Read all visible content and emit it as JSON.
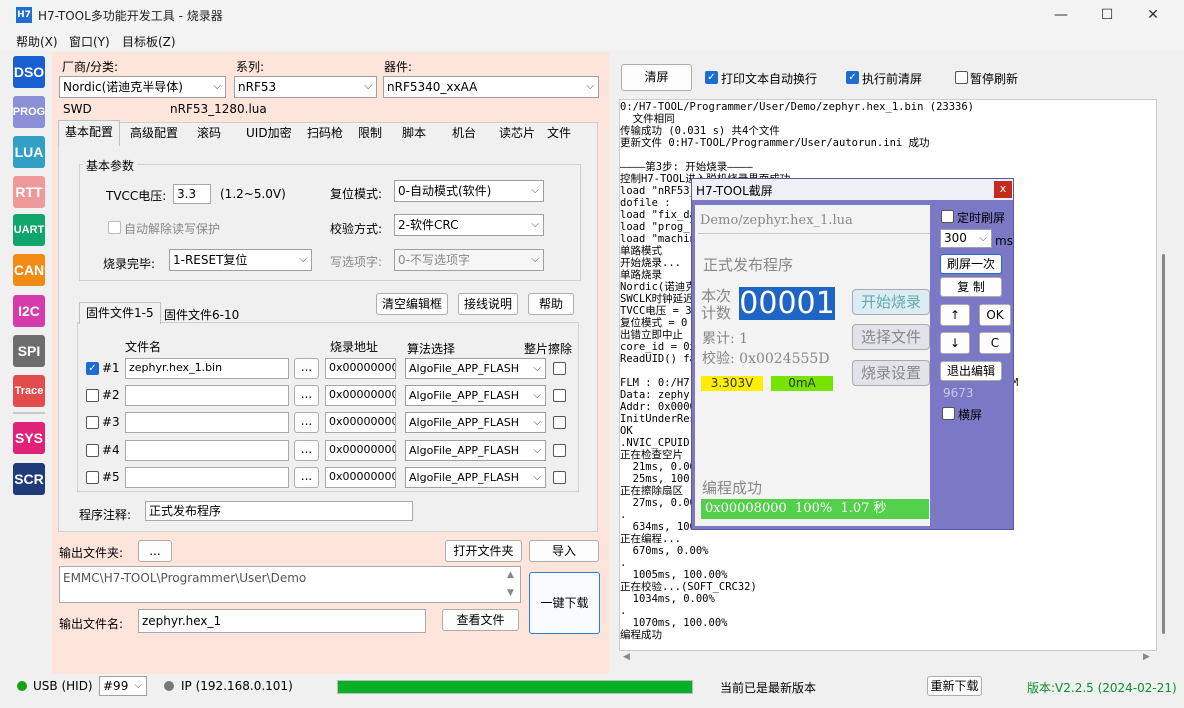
{
  "window": {
    "title": "H7-TOOL多功能开发工具 - 烧录器",
    "app_icon": "H7"
  },
  "menu": [
    "帮助(X)",
    "窗口(Y)",
    "目标板(Z)"
  ],
  "sidebar": [
    {
      "label": "DSO",
      "color": "#1a5fcf"
    },
    {
      "label": "PROG",
      "color": "#8a8fd6"
    },
    {
      "label": "LUA",
      "color": "#32a0c4"
    },
    {
      "label": "RTT",
      "color": "#ef9a9a"
    },
    {
      "label": "UART",
      "color": "#10a56a"
    },
    {
      "label": "CAN",
      "color": "#f28b16"
    },
    {
      "label": "I2C",
      "color": "#d63bab"
    },
    {
      "label": "SPI",
      "color": "#6d6d6d"
    },
    {
      "label": "Trace",
      "color": "#e24c4c"
    },
    {
      "label": "SYS",
      "color": "#e02279"
    },
    {
      "label": "SCR",
      "color": "#1f3b7a"
    }
  ],
  "selectors": {
    "vendor_label": "厂商/分类:",
    "vendor": "Nordic(诺迪克半导体)",
    "series_label": "系列:",
    "series": "nRF53",
    "device_label": "器件:",
    "device": "nRF5340_xxAA",
    "interface": "SWD",
    "lua_file": "nRF53_1280.lua"
  },
  "tabs": [
    "基本配置",
    "高级配置",
    "滚码",
    "UID加密",
    "扫码枪",
    "限制",
    "脚本",
    "机台",
    "读芯片",
    "文件"
  ],
  "basic": {
    "group_title": "基本参数",
    "tvcc_label": "TVCC电压:",
    "tvcc_value": "3.3",
    "tvcc_range": "(1.2~5.0V)",
    "reset_label": "复位模式:",
    "reset_value": "0-自动模式(软件)",
    "auto_unlock_label": "自动解除读写保护",
    "verify_label": "校验方式:",
    "verify_value": "2-软件CRC",
    "finish_label": "烧录完毕:",
    "finish_value": "1-RESET复位",
    "write_opt_label": "写选项字:",
    "write_opt_value": "0-不写选项字"
  },
  "firmware": {
    "tabs": [
      "固件文件1-5",
      "固件文件6-10"
    ],
    "clear_btn": "清空编辑框",
    "wiring_btn": "接线说明",
    "help_btn": "帮助",
    "col_file": "文件名",
    "col_addr": "烧录地址",
    "col_algo": "算法选择",
    "col_erase": "整片擦除",
    "browse": "...",
    "rows": [
      {
        "id": "#1",
        "checked": true,
        "file": "zephyr.hex_1.bin",
        "addr": "0x00000000",
        "algo": "AlgoFile_APP_FLASH"
      },
      {
        "id": "#2",
        "checked": false,
        "file": "",
        "addr": "0x00000000",
        "algo": "AlgoFile_APP_FLASH"
      },
      {
        "id": "#3",
        "checked": false,
        "file": "",
        "addr": "0x00000000",
        "algo": "AlgoFile_APP_FLASH"
      },
      {
        "id": "#4",
        "checked": false,
        "file": "",
        "addr": "0x00000000",
        "algo": "AlgoFile_APP_FLASH"
      },
      {
        "id": "#5",
        "checked": false,
        "file": "",
        "addr": "0x00000000",
        "algo": "AlgoFile_APP_FLASH"
      }
    ],
    "note_label": "程序注释:",
    "note_value": "正式发布程序"
  },
  "output": {
    "folder_label": "输出文件夹:",
    "folder_btn": "...",
    "open_folder_btn": "打开文件夹",
    "import_btn": "导入",
    "path": "EMMC\\H7-TOOL\\Programmer\\User\\Demo",
    "one_click_btn": "一键下载",
    "name_label": "输出文件名:",
    "name_value": "zephyr.hex_1",
    "view_btn": "查看文件"
  },
  "log_toolbar": {
    "clear_btn": "清屏",
    "wrap_label": "打印文本自动换行",
    "clear_before_label": "执行前清屏",
    "pause_label": "暂停刷新"
  },
  "log_lines": [
    "0:/H7-TOOL/Programmer/User/Demo/zephyr.hex_1.bin (23336)",
    "  文件相同",
    "传输成功 (0.031 s) 共4个文件",
    "更新文件 0:H7-TOOL/Programmer/User/autorun.ini 成功",
    "",
    "————第3步: 开始烧录————",
    "控制H7-TOOL进入脱机烧录界面成功",
    "load \"nRF53_",
    "dofile :",
    "load \"fix_da",
    "load \"prog_l",
    "load \"machin",
    "单路模式",
    "开始烧录...",
    "单路烧录",
    "Nordic(诺迪克",
    "SWCLK时钟延迟",
    "TVCC电压 = 3",
    "复位模式 = 0",
    "出错立即中止",
    "core_id = 0x",
    "ReadUID() fa",
    "",
    "FLM : 0:/H7-                                                FLM",
    "Data: zephyr",
    "Addr: 0x0000",
    "InitUnderRes",
    "OK",
    ".NVIC_CPUID",
    "正在检查空片",
    "  21ms, 0.00",
    "  25ms, 100.",
    "正在擦除扇区",
    "  27ms, 0.00",
    ".",
    "  634ms, 100",
    "正在编程...",
    "  670ms, 0.00%",
    ".",
    "  1005ms, 100.00%",
    "正在校验...(SOFT_CRC32)",
    "  1034ms, 0.00%",
    ".",
    "  1070ms, 100.00%",
    "编程成功"
  ],
  "dialog": {
    "title": "H7-TOOL截屏",
    "close": "x",
    "file": "Demo/zephyr.hex_1.lua",
    "program": "正式发布程序",
    "count_label1": "本次",
    "count_label2": "计数",
    "count": "00001",
    "start_btn": "开始烧录",
    "total_label": "累计: 1",
    "select_btn": "选择文件",
    "checksum_label": "校验: 0x0024555D",
    "voltage": "3.303V",
    "current": "0mA",
    "settings_btn": "烧录设置",
    "status": "编程成功",
    "result": "0x00008000  100%  1.07 秒",
    "timer_label": "定时刷屏",
    "interval": "300",
    "ms": "ms",
    "refresh_btn": "刷屏一次",
    "copy_btn": "复 制",
    "up_btn": "↑",
    "ok_btn": "OK",
    "down_btn": "↓",
    "c_btn": "C",
    "exit_edit_btn": "退出编辑",
    "code": "9673",
    "landscape_label": "横屏"
  },
  "status": {
    "usb": "USB (HID)",
    "device_num": "#99",
    "ip": "IP (192.168.0.101)",
    "progress": 1.0,
    "update_msg": "当前已是最新版本",
    "redownload_btn": "重新下载",
    "version": "版本:V2.2.5 (2024-02-21)"
  }
}
